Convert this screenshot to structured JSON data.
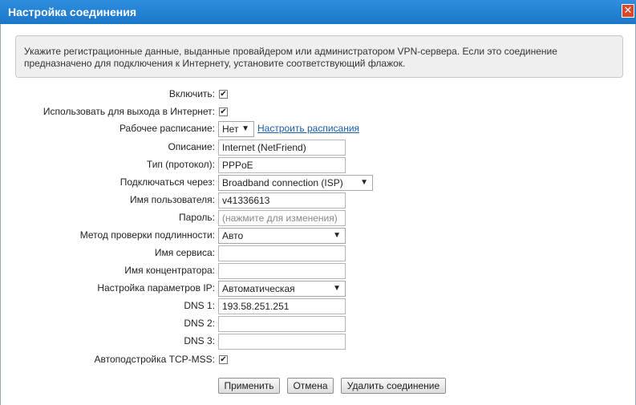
{
  "window": {
    "title": "Настройка соединения",
    "close_symbol": "✕"
  },
  "info_text": "Укажите регистрационные данные, выданные провайдером или администратором VPN-сервера. Если это соединение предназначено для подключения к Интернету, установите соответствующий флажок.",
  "form": {
    "enable": {
      "label": "Включить:",
      "checked": true
    },
    "internet": {
      "label": "Использовать для выхода в Интернет:",
      "checked": true
    },
    "schedule": {
      "label": "Рабочее расписание:",
      "value": "Нет",
      "link": "Настроить расписания"
    },
    "description": {
      "label": "Описание:",
      "value": "Internet (NetFriend)"
    },
    "protocol": {
      "label": "Тип (протокол):",
      "value": "PPPoE"
    },
    "connect_via": {
      "label": "Подключаться через:",
      "value": "Broadband connection (ISP)"
    },
    "username": {
      "label": "Имя пользователя:",
      "value": "v41336613"
    },
    "password": {
      "label": "Пароль:",
      "placeholder": "(нажмите для изменения)"
    },
    "auth_method": {
      "label": "Метод проверки подлинности:",
      "value": "Авто"
    },
    "service_name": {
      "label": "Имя сервиса:",
      "value": ""
    },
    "concentrator_name": {
      "label": "Имя концентратора:",
      "value": ""
    },
    "ip_settings": {
      "label": "Настройка параметров IP:",
      "value": "Автоматическая"
    },
    "dns1": {
      "label": "DNS 1:",
      "value": "193.58.251.251"
    },
    "dns2": {
      "label": "DNS 2:",
      "value": ""
    },
    "dns3": {
      "label": "DNS 3:",
      "value": ""
    },
    "tcp_mss": {
      "label": "Автоподстройка TCP-MSS:",
      "checked": true
    }
  },
  "buttons": {
    "apply": "Применить",
    "cancel": "Отмена",
    "delete": "Удалить соединение"
  },
  "symbols": {
    "check": "✔",
    "arrow": "▼"
  },
  "colors": {
    "titlebar": "#1a76c8",
    "close": "#d9482b",
    "link": "#1b5da8"
  }
}
